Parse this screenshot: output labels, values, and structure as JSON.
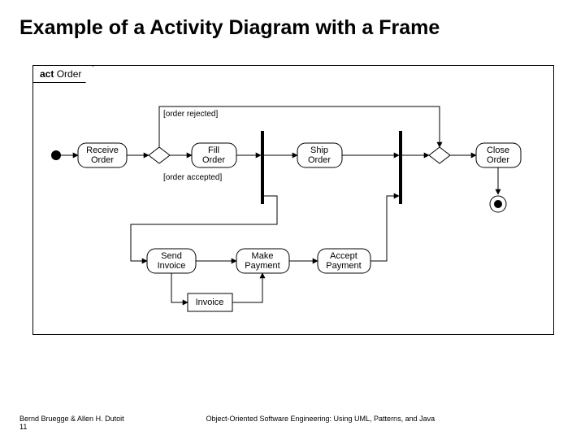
{
  "title": "Example of a Activity Diagram with a Frame",
  "frame": {
    "keyword": "act",
    "name": "Order"
  },
  "guards": {
    "rejected": "[order rejected]",
    "accepted": "[order accepted]"
  },
  "activities": {
    "receive": "Receive Order",
    "fill": "Fill Order",
    "ship": "Ship Order",
    "close": "Close Order",
    "sendInvoice": "Send Invoice",
    "makePayment": "Make Payment",
    "acceptPayment": "Accept Payment"
  },
  "object": "Invoice",
  "footer": {
    "authors": "Bernd Bruegge & Allen H. Dutoit",
    "page": "11",
    "book": "Object-Oriented Software Engineering: Using UML, Patterns, and Java"
  }
}
